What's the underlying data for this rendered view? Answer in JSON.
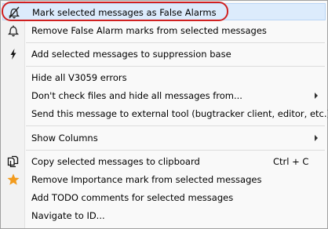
{
  "menu": {
    "items": [
      {
        "label": "Mark selected messages as False Alarms",
        "icon": "bell-slash-icon",
        "highlighted": true
      },
      {
        "label": "Remove False Alarm marks from selected messages",
        "icon": "bell-icon"
      },
      {
        "label": "Add selected messages to suppression base",
        "icon": "lightning-icon"
      },
      {
        "label": "Hide all V3059 errors"
      },
      {
        "label": "Don't check files and hide all messages from...",
        "submenu": true
      },
      {
        "label": "Send this message to external tool (bugtracker client, editor, etc.)"
      },
      {
        "label": "Show Columns",
        "submenu": true
      },
      {
        "label": "Copy selected messages to clipboard",
        "icon": "copy-icon",
        "shortcut": "Ctrl + C"
      },
      {
        "label": "Remove Importance mark from selected messages",
        "icon": "star-icon"
      },
      {
        "label": "Add TODO comments for selected messages"
      },
      {
        "label": "Navigate to ID..."
      }
    ]
  },
  "colors": {
    "highlight": "#dcebfc",
    "annotation": "#d02020",
    "star": "#f29b1d"
  }
}
